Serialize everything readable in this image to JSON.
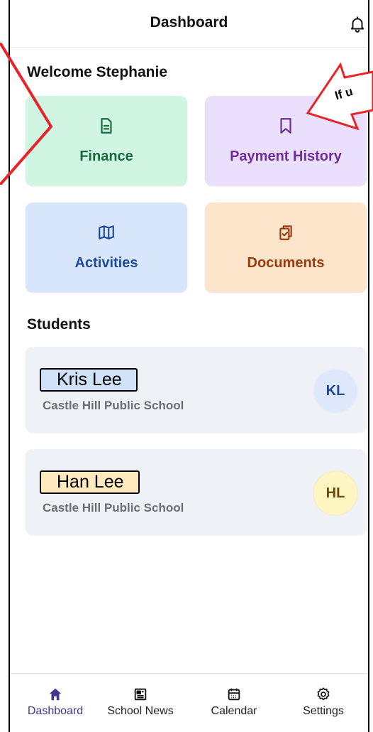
{
  "header": {
    "title": "Dashboard",
    "bell_icon": "bell-icon"
  },
  "welcome": "Welcome Stephanie",
  "cards": [
    {
      "label": "Finance",
      "icon": "document-icon",
      "color": "#166a3d",
      "bg": "#d1f5e3"
    },
    {
      "label": "Payment History",
      "icon": "bookmark-icon",
      "color": "#6f2d9c",
      "bg": "#eadffc"
    },
    {
      "label": "Activities",
      "icon": "map-icon",
      "color": "#1d4a9a",
      "bg": "#d7e6fb"
    },
    {
      "label": "Documents",
      "icon": "clipboard-icon",
      "color": "#9a3a10",
      "bg": "#fde5cc"
    }
  ],
  "students_heading": "Students",
  "students": [
    {
      "name": "Kris Lee",
      "school": "Castle Hill Public School",
      "initials": "KL"
    },
    {
      "name": "Han Lee",
      "school": "Castle Hill Public School",
      "initials": "HL"
    }
  ],
  "tabs": [
    {
      "label": "Dashboard",
      "icon": "home-icon",
      "active": true
    },
    {
      "label": "School News",
      "icon": "newspaper-icon"
    },
    {
      "label": "Calendar",
      "icon": "calendar-icon"
    },
    {
      "label": "Settings",
      "icon": "gear-icon"
    }
  ],
  "annotation": {
    "callout_text": "If u"
  },
  "colors": {
    "accent": "#3b3a8f",
    "annotation_red": "#e8232a"
  }
}
